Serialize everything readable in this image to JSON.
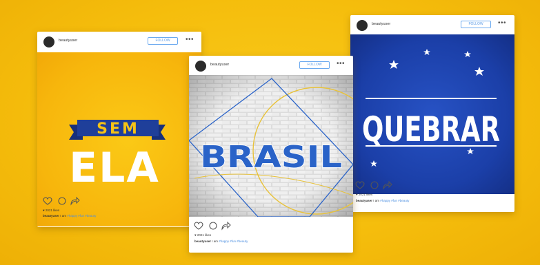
{
  "posts": [
    {
      "username": "beautyuser",
      "follow_label": "FOLLOW",
      "more_label": "•••",
      "image_text": [
        "SEM",
        "ELA"
      ],
      "likes": "♥ 2021 likes",
      "caption_user": "beautyuser",
      "caption_text": " I am ",
      "caption_tags": "#happy #fun #beauty"
    },
    {
      "username": "beautyuser",
      "follow_label": "FOLLOW",
      "more_label": "•••",
      "image_text": "BRASIL",
      "likes": "♥ 2021 likes",
      "caption_user": "beautyuser",
      "caption_text": " I am ",
      "caption_tags": "#happy #fun #beauty"
    },
    {
      "username": "beautyuser",
      "follow_label": "FOLLOW",
      "more_label": "•••",
      "image_text": "QUEBRAR",
      "likes": "♥ 2021 likes",
      "caption_user": "beautyuser",
      "caption_text": " I am ",
      "caption_tags": "#happy #fun #beauty"
    }
  ],
  "colors": {
    "background": "#f6c315",
    "sem_ela_bg": "#f7b80d",
    "ribbon_blue": "#1f3f9a",
    "ribbon_text": "#f6c315",
    "brasil_blue": "#2a63c8",
    "quebrar_bg": "#1b3fa8",
    "follow_blue": "#5a9ae6"
  },
  "icons": [
    "heart-icon",
    "comment-icon",
    "share-icon",
    "star-icon"
  ]
}
